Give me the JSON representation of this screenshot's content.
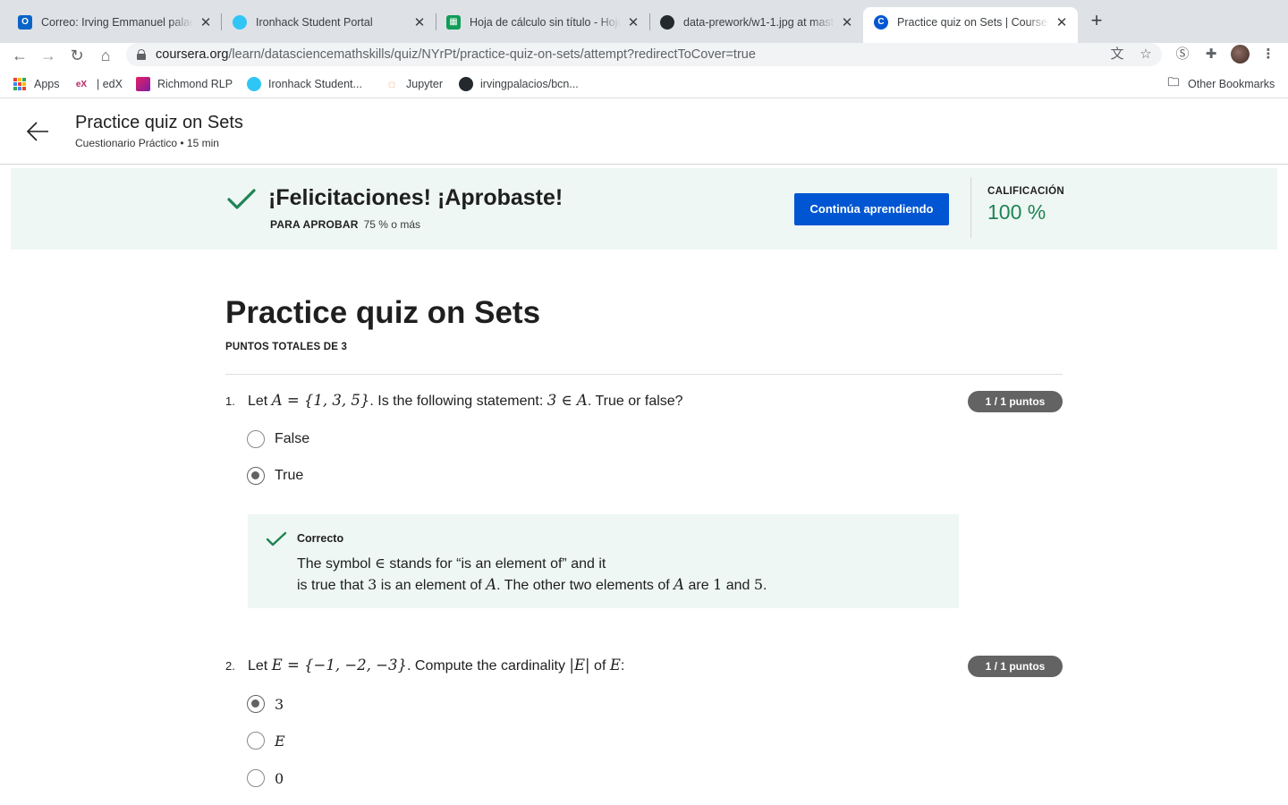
{
  "browser": {
    "tabs": [
      {
        "title": "Correo: Irving Emmanuel palacios",
        "favicon": "outlook-icon",
        "active": false
      },
      {
        "title": "Ironhack Student Portal",
        "favicon": "ironhack-icon",
        "active": false
      },
      {
        "title": "Hoja de cálculo sin título - Hojas",
        "favicon": "sheets-icon",
        "active": false
      },
      {
        "title": "data-prework/w1-1.jpg at master",
        "favicon": "github-icon",
        "active": false
      },
      {
        "title": "Practice quiz on Sets | Coursera",
        "favicon": "coursera-icon",
        "active": true
      }
    ],
    "url_host": "coursera.org",
    "url_path": "/learn/datasciencemathskills/quiz/NYrPt/practice-quiz-on-sets/attempt?redirectToCover=true",
    "bookmarks": [
      {
        "label": "Apps",
        "icon": "apps-grid-icon"
      },
      {
        "label": "| edX",
        "icon": "edx-icon"
      },
      {
        "label": "Richmond RLP",
        "icon": "richmond-icon"
      },
      {
        "label": "Ironhack Student...",
        "icon": "ironhack-icon"
      },
      {
        "label": "Jupyter",
        "icon": "jupyter-icon"
      },
      {
        "label": "irvingpalacios/bcn...",
        "icon": "github-icon"
      }
    ],
    "other_bookmarks": "Other Bookmarks"
  },
  "header": {
    "title": "Practice quiz on Sets",
    "subtitle": "Cuestionario Práctico • 15 min"
  },
  "banner": {
    "message": "¡Felicitaciones! ¡Aprobaste!",
    "pass_label": "PARA APROBAR",
    "pass_value": "75 % o más",
    "continue_label": "Continúa aprendiendo",
    "grade_label": "CALIFICACIÓN",
    "grade_value": "100 %",
    "accent_color": "#1f8354",
    "button_color": "#0056d2"
  },
  "quiz": {
    "heading": "Practice quiz on Sets",
    "total_points": "PUNTOS TOTALES DE 3",
    "questions": [
      {
        "number": "1.",
        "text_parts": [
          "Let ",
          "A = {1, 3, 5}",
          ". Is the following statement:  ",
          "3 ∈ A",
          ".  True or false?"
        ],
        "score": "1 / 1 puntos",
        "options": [
          {
            "label": "False",
            "selected": false
          },
          {
            "label": "True",
            "selected": true
          }
        ],
        "feedback": {
          "title": "Correcto",
          "line1_parts": [
            "The symbol ",
            "∈",
            " stands for “is an element of” and it"
          ],
          "line2_parts": [
            "is true that ",
            "3",
            " is an element of ",
            "A",
            ". The other two elements of ",
            "A",
            " are ",
            "1",
            " and ",
            "5",
            "."
          ]
        }
      },
      {
        "number": "2.",
        "text_parts": [
          "Let ",
          "E = {−1, −2, −3}",
          ". Compute the cardinality ",
          "|E|",
          " of ",
          "E",
          ":"
        ],
        "score": "1 / 1 puntos",
        "options": [
          {
            "label": "3",
            "selected": true
          },
          {
            "label": "E",
            "selected": false
          },
          {
            "label": "0",
            "selected": false
          }
        ]
      }
    ]
  }
}
